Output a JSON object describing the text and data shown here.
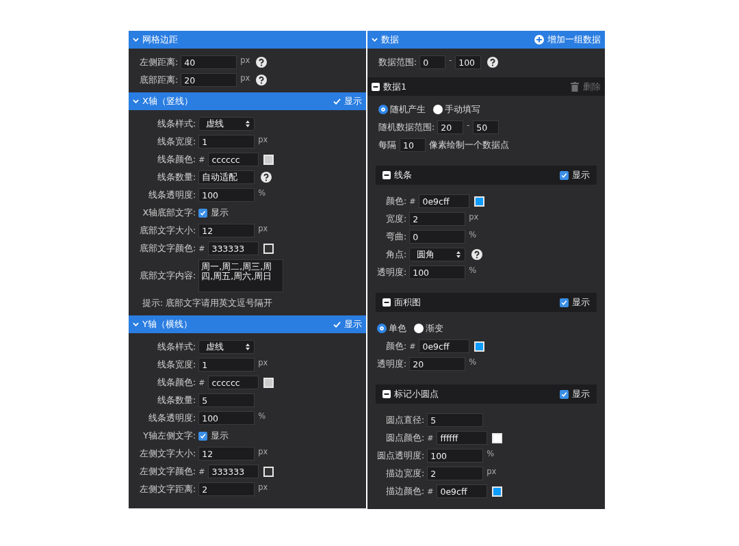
{
  "panels": [
    {
      "sections": [
        {
          "kind": "group",
          "title": "网格边距",
          "rows": [
            {
              "kind": "input",
              "label": "左侧距离:",
              "value": "40",
              "unit": "px",
              "help": true
            },
            {
              "kind": "input",
              "label": "底部距离:",
              "value": "20",
              "unit": "px",
              "help": true
            }
          ]
        },
        {
          "kind": "group",
          "title": "X轴（竖线）",
          "toggle": {
            "label": "显示",
            "checked": true
          },
          "rows": [
            {
              "kind": "select",
              "label": "线条样式:",
              "value": "虚线"
            },
            {
              "kind": "input",
              "label": "线条宽度:",
              "value": "1",
              "unit": "px"
            },
            {
              "kind": "input",
              "label": "线条颜色:",
              "prefix": "#",
              "value": "cccccc",
              "swatch": true
            },
            {
              "kind": "input",
              "label": "线条数量:",
              "value": "自动适配",
              "help": true
            },
            {
              "kind": "input",
              "label": "线条透明度:",
              "value": "100",
              "unit": "%"
            },
            {
              "kind": "check",
              "label": "X轴底部文字:",
              "text": "显示",
              "checked": true
            },
            {
              "kind": "input",
              "label": "底部文字大小:",
              "value": "12",
              "unit": "px"
            },
            {
              "kind": "input",
              "label": "底部文字颜色:",
              "prefix": "#",
              "value": "333333",
              "swatch": true
            },
            {
              "kind": "textarea",
              "label": "底部文字内容:",
              "value": "周一,周二,周三,周四,周五,周六,周日"
            },
            {
              "kind": "hint",
              "text": "提示: 底部文字请用英文逗号隔开"
            }
          ]
        },
        {
          "kind": "group",
          "title": "Y轴（横线）",
          "toggle": {
            "label": "显示",
            "checked": true
          },
          "rows": [
            {
              "kind": "select",
              "label": "线条样式:",
              "value": "虚线"
            },
            {
              "kind": "input",
              "label": "线条宽度:",
              "value": "1",
              "unit": "px"
            },
            {
              "kind": "input",
              "label": "线条颜色:",
              "prefix": "#",
              "value": "cccccc",
              "swatch": true
            },
            {
              "kind": "input",
              "label": "线条数量:",
              "value": "5"
            },
            {
              "kind": "input",
              "label": "线条透明度:",
              "value": "100",
              "unit": "%"
            },
            {
              "kind": "check",
              "label": "Y轴左侧文字:",
              "text": "显示",
              "checked": true
            },
            {
              "kind": "input",
              "label": "左侧文字大小:",
              "value": "12",
              "unit": "px"
            },
            {
              "kind": "input",
              "label": "左侧文字颜色:",
              "prefix": "#",
              "value": "333333",
              "swatch": true
            },
            {
              "kind": "input",
              "label": "左侧文字距离:",
              "value": "2",
              "unit": "px"
            }
          ]
        }
      ]
    },
    {
      "sections": [
        {
          "kind": "group",
          "title": "数据",
          "action": {
            "kind": "add",
            "label": "增加一组数据",
            "disabled": false
          },
          "rows": [
            {
              "kind": "range",
              "label": "数据范围:",
              "from": "0",
              "separator": "-",
              "to": "100",
              "help": true
            }
          ]
        },
        {
          "kind": "item",
          "title": "数据1",
          "action": {
            "kind": "delete",
            "label": "删除",
            "disabled": true
          },
          "rows": [
            {
              "kind": "radio",
              "options": [
                {
                  "label": "随机产生",
                  "selected": true
                },
                {
                  "label": "手动填写",
                  "selected": false
                }
              ]
            },
            {
              "kind": "range",
              "label": "随机数据范围:",
              "from": "20",
              "separator": "-",
              "to": "50"
            },
            {
              "kind": "interval",
              "before": "每隔",
              "value": "10",
              "after": "像素绘制一个数据点"
            }
          ]
        },
        {
          "kind": "part",
          "title": "线条",
          "toggle": {
            "label": "显示",
            "checked": true
          },
          "rows": [
            {
              "kind": "input",
              "label": "颜色:",
              "prefix": "#",
              "value": "0e9cff",
              "swatch": true
            },
            {
              "kind": "input",
              "label": "宽度:",
              "value": "2",
              "unit": "px"
            },
            {
              "kind": "input",
              "label": "弯曲:",
              "value": "0",
              "unit": "%"
            },
            {
              "kind": "select",
              "label": "角点:",
              "value": "圆角",
              "help": true
            },
            {
              "kind": "input",
              "label": "透明度:",
              "value": "100",
              "unit": "%"
            }
          ]
        },
        {
          "kind": "part",
          "title": "面积图",
          "toggle": {
            "label": "显示",
            "checked": true
          },
          "rows": [
            {
              "kind": "radio",
              "options": [
                {
                  "label": "单色",
                  "selected": true
                },
                {
                  "label": "渐变",
                  "selected": false
                }
              ]
            },
            {
              "kind": "input",
              "label": "颜色:",
              "prefix": "#",
              "value": "0e9cff",
              "swatch": true
            },
            {
              "kind": "input",
              "label": "透明度:",
              "value": "20",
              "unit": "%"
            }
          ]
        },
        {
          "kind": "part",
          "title": "标记小圆点",
          "toggle": {
            "label": "显示",
            "checked": true
          },
          "rows": [
            {
              "kind": "input",
              "label": "圆点直径:",
              "value": "5"
            },
            {
              "kind": "input",
              "label": "圆点颜色:",
              "prefix": "#",
              "value": "ffffff",
              "swatch": true
            },
            {
              "kind": "input",
              "label": "圆点透明度:",
              "value": "100",
              "unit": "%"
            },
            {
              "kind": "input",
              "label": "描边宽度:",
              "value": "2",
              "unit": "px"
            },
            {
              "kind": "input",
              "label": "描边颜色:",
              "prefix": "#",
              "value": "0e9cff",
              "swatch": true
            }
          ]
        }
      ]
    }
  ]
}
